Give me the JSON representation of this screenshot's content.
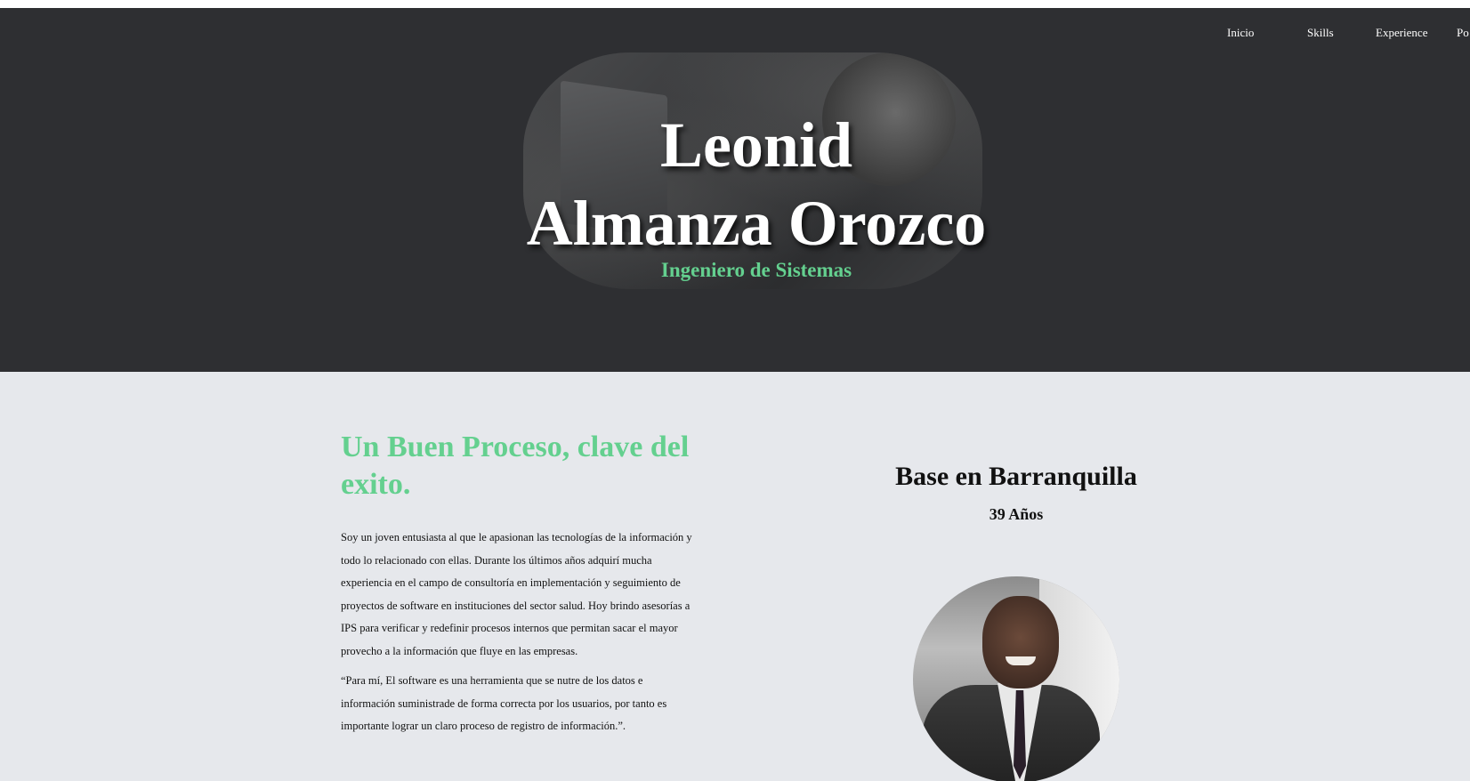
{
  "nav": {
    "items": [
      {
        "label": "Inicio"
      },
      {
        "label": "Skills"
      },
      {
        "label": "Experience"
      },
      {
        "label": "Po"
      }
    ]
  },
  "hero": {
    "first_name": "Leonid",
    "last_name": "Almanza Orozco",
    "subtitle": "Ingeniero de Sistemas"
  },
  "about": {
    "heading": "Un Buen Proceso, clave del exito.",
    "paragraph1": "Soy un joven entusiasta al que le apasionan las tecnologías de la información y todo lo relacionado con ellas. Durante los últimos años adquirí mucha experiencia en el campo de consultoría en implementación y seguimiento de proyectos de software en instituciones del sector salud. Hoy brindo asesorías a IPS para verificar y redefinir procesos internos que permitan sacar el mayor provecho a la información que fluye en las empresas.",
    "paragraph2": "“Para mí, El software es una herramienta que se nutre de los datos e información suministrade de forma correcta por los usuarios, por tanto es importante lograr un claro proceso de registro de información.”."
  },
  "profile": {
    "location": "Base en Barranquilla",
    "age": "39 Años"
  },
  "colors": {
    "hero_bg": "#2e2f32",
    "accent_green": "#64d08f",
    "content_bg": "#e6e8ec"
  }
}
